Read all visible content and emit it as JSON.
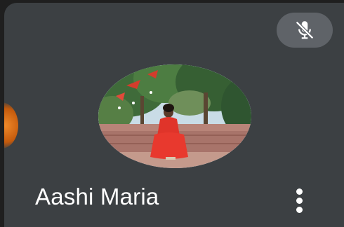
{
  "participant": {
    "name": "Aashi Maria",
    "microphone": "muted"
  },
  "icons": {
    "mute": "mic-off-icon",
    "more": "more-vert-icon"
  },
  "colors": {
    "tile_background": "#3c4043",
    "mute_button_background": "#5f6368",
    "name_text": "#ffffff",
    "accent": "#f08a2a"
  }
}
